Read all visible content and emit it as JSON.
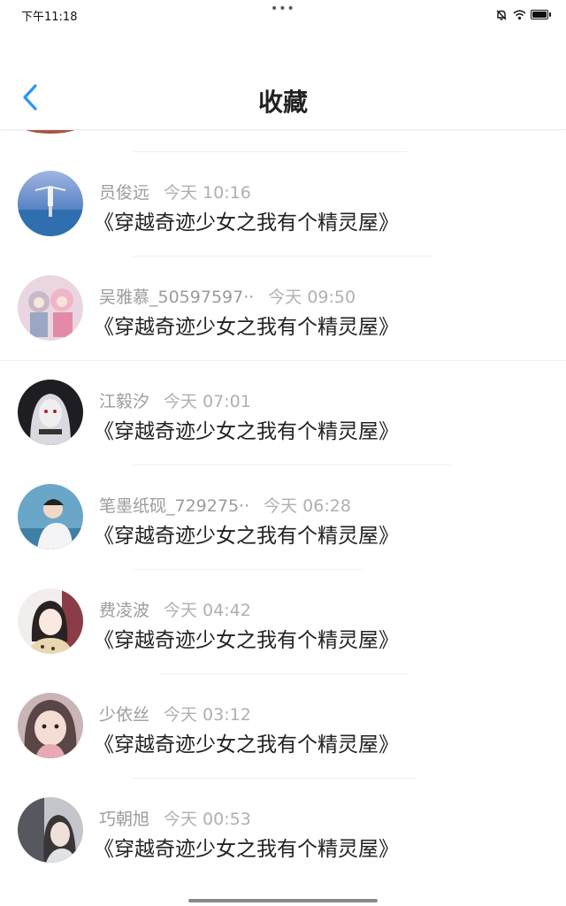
{
  "status_bar": {
    "time": "下午11:18",
    "dots": "•••"
  },
  "header": {
    "title": "收藏"
  },
  "items": [
    {
      "user": "员俊远",
      "time": "今天 10:16",
      "title": "《穿越奇迹少女之我有个精灵屋》"
    },
    {
      "user": "吴雅慕_50597597··",
      "time": "今天 09:50",
      "title": "《穿越奇迹少女之我有个精灵屋》"
    },
    {
      "user": "江毅汐",
      "time": "今天 07:01",
      "title": "《穿越奇迹少女之我有个精灵屋》"
    },
    {
      "user": "笔墨纸砚_729275··",
      "time": "今天 06:28",
      "title": "《穿越奇迹少女之我有个精灵屋》"
    },
    {
      "user": "费凌波",
      "time": "今天 04:42",
      "title": "《穿越奇迹少女之我有个精灵屋》"
    },
    {
      "user": "少依丝",
      "time": "今天 03:12",
      "title": "《穿越奇迹少女之我有个精灵屋》"
    },
    {
      "user": "巧朝旭",
      "time": "今天 00:53",
      "title": "《穿越奇迹少女之我有个精灵屋》"
    }
  ],
  "colors": {
    "accent": "#2b95f5",
    "text": "#222222",
    "meta": "#9c9c9c"
  }
}
